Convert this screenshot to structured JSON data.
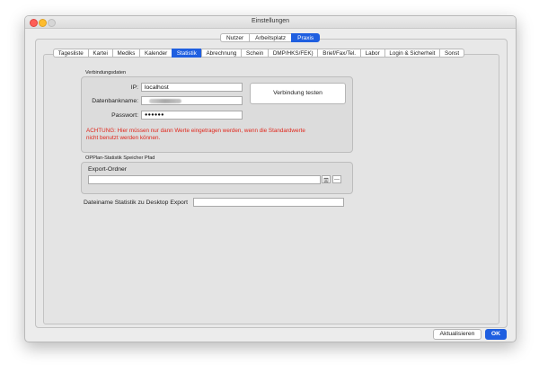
{
  "window": {
    "title": "Einstellungen"
  },
  "top_tabs": [
    {
      "label": "Nutzer",
      "active": false
    },
    {
      "label": "Arbeitsplatz",
      "active": false
    },
    {
      "label": "Praxis",
      "active": true
    }
  ],
  "tabs": [
    {
      "label": "Tagesliste",
      "active": false
    },
    {
      "label": "Kartei",
      "active": false
    },
    {
      "label": "Mediks",
      "active": false
    },
    {
      "label": "Kalender",
      "active": false
    },
    {
      "label": "Statistik",
      "active": true
    },
    {
      "label": "Abrechnung",
      "active": false
    },
    {
      "label": "Schein",
      "active": false
    },
    {
      "label": "DMP/HKS/FEK)",
      "active": false
    },
    {
      "label": "Brief/Fax/Tel.",
      "active": false
    },
    {
      "label": "Labor",
      "active": false
    },
    {
      "label": "Login & Sicherheit",
      "active": false
    },
    {
      "label": "Sonst",
      "active": false
    }
  ],
  "connection": {
    "group_label": "Verbindungsdaten",
    "ip_label": "IP:",
    "ip_value": "localhost",
    "db_label": "Datenbankname:",
    "password_label": "Passwort:",
    "password_value": "●●●●●●",
    "test_button": "Verbindung testen",
    "warning_line1": "ACHTUNG: Hier müssen nur dann Werte eingetragen werden, wenn die Standardwerte",
    "warning_line2": "nicht benutzt werden können."
  },
  "export": {
    "group_label": "OPPlan-Statistik Speicher Pfad",
    "folder_label": "Export-Ordner",
    "folder_value": "",
    "minus_label": "—"
  },
  "filename": {
    "label": "Dateiname Statistik zu Desktop Export",
    "value": ""
  },
  "footer": {
    "refresh_button": "Aktualisieren",
    "ok_button": "OK"
  },
  "colors": {
    "accent": "#1f5fe0",
    "warning": "#e0261b"
  }
}
